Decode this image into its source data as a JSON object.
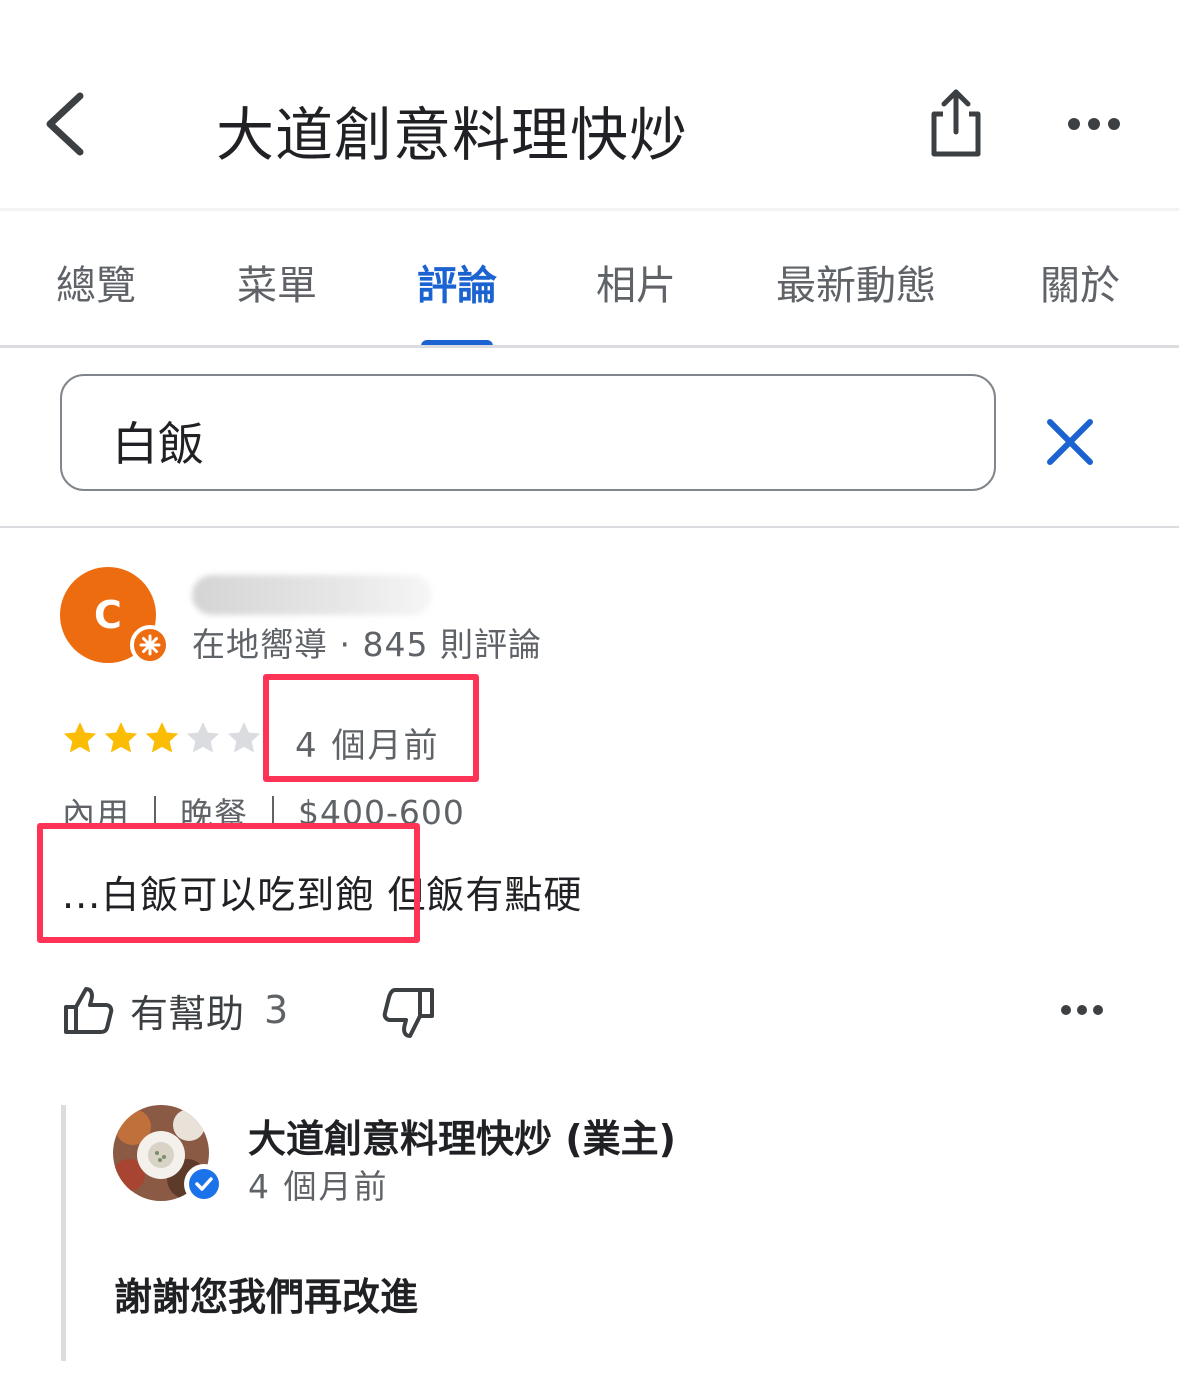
{
  "header": {
    "title": "大道創意料理快炒",
    "back_icon": "chevron-left-icon",
    "share_icon": "share-icon",
    "more_icon": "more-horizontal-icon"
  },
  "tabs": [
    {
      "label": "總覽",
      "active": false
    },
    {
      "label": "菜單",
      "active": false
    },
    {
      "label": "評論",
      "active": true
    },
    {
      "label": "相片",
      "active": false
    },
    {
      "label": "最新動態",
      "active": false
    },
    {
      "label": "關於",
      "active": false
    }
  ],
  "search": {
    "value": "白飯",
    "clear_icon": "close-icon"
  },
  "review": {
    "avatar_letter": "C",
    "reviewer_meta": "在地嚮導 · 845 則評論",
    "rating": 3,
    "rating_max": 5,
    "time": "4 個月前",
    "tags": [
      "內用",
      "晚餐",
      "$400-600"
    ],
    "text": "...白飯可以吃到飽 但飯有點硬",
    "helpful_label": "有幫助",
    "helpful_count": "3"
  },
  "owner_reply": {
    "name": "大道創意料理快炒 (業主)",
    "time": "4 個月前",
    "text": "謝謝您我們再改進"
  },
  "colors": {
    "accent": "#1a63d0",
    "avatar_bg": "#ee6c10",
    "star_filled": "#fbbc04",
    "star_empty": "#dadce0",
    "highlight_box": "#ff3355"
  }
}
